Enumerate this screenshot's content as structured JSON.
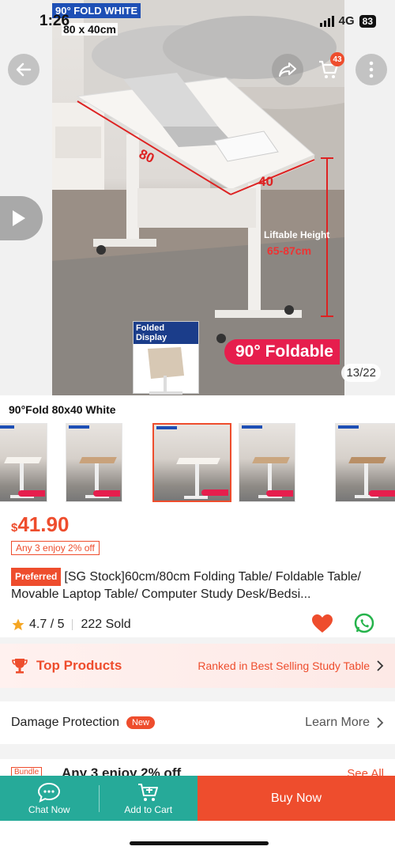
{
  "status_bar": {
    "time": "1:26",
    "network": "4G",
    "battery": "83"
  },
  "hero": {
    "fold_label": "90° FOLD WHITE",
    "size_label": "80 x 40cm",
    "dim_length": "80",
    "dim_width": "40",
    "lift_label": "Liftable Height",
    "lift_range": "65-87cm",
    "folded_display": "Folded Display",
    "foldable": "90° Foldable",
    "image_counter": "13/22",
    "cart_count": "43"
  },
  "variant": {
    "selected_name": "90°Fold 80x40 White",
    "thumbnails": [
      {
        "name": "variant-1",
        "selected": false
      },
      {
        "name": "variant-2",
        "selected": false
      },
      {
        "name": "variant-3",
        "selected": true
      },
      {
        "name": "variant-4",
        "selected": false
      },
      {
        "name": "variant-5",
        "selected": false
      }
    ]
  },
  "product": {
    "currency": "$",
    "price": "41.90",
    "promo": "Any 3 enjoy 2% off",
    "preferred_badge": "Preferred",
    "title": "[SG Stock]60cm/80cm Folding Table/ Foldable Table/ Movable Laptop Table/ Computer Study Desk/Bedsi...",
    "rating": "4.7 / 5",
    "sold": "222 Sold"
  },
  "top_products": {
    "label": "Top Products",
    "ranked": "Ranked in Best Selling Study Table"
  },
  "damage_protection": {
    "label": "Damage Protection",
    "badge": "New",
    "action": "Learn More"
  },
  "bundle": {
    "tag": "Bundle",
    "text": "Any 3 enjoy 2% off",
    "see_all": "See All"
  },
  "bottom_bar": {
    "chat_label": "Chat Now",
    "cart_label": "Add to Cart",
    "buy_label": "Buy Now"
  },
  "colors": {
    "brand": "#ee4d2d",
    "teal": "#26aa99"
  }
}
